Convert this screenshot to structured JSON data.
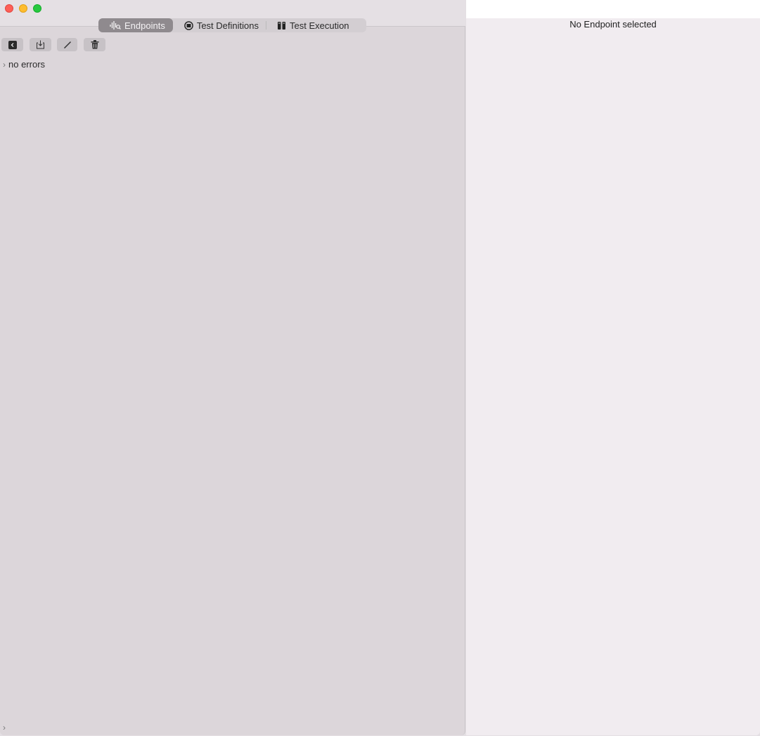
{
  "window": {
    "controls": [
      "close",
      "minimize",
      "zoom"
    ]
  },
  "tabs": [
    {
      "label": "Endpoints",
      "icon": "waveform-magnifier-icon",
      "selected": true
    },
    {
      "label": "Test Definitions",
      "icon": "list-circle-icon",
      "selected": false
    },
    {
      "label": "Test Execution",
      "icon": "test-tubes-icon",
      "selected": false
    }
  ],
  "toolbar": {
    "buttons": [
      "collapse-sidebar",
      "import",
      "edit",
      "delete"
    ]
  },
  "sidebar": {
    "status": "no errors"
  },
  "detail": {
    "empty_message": "No Endpoint selected"
  }
}
